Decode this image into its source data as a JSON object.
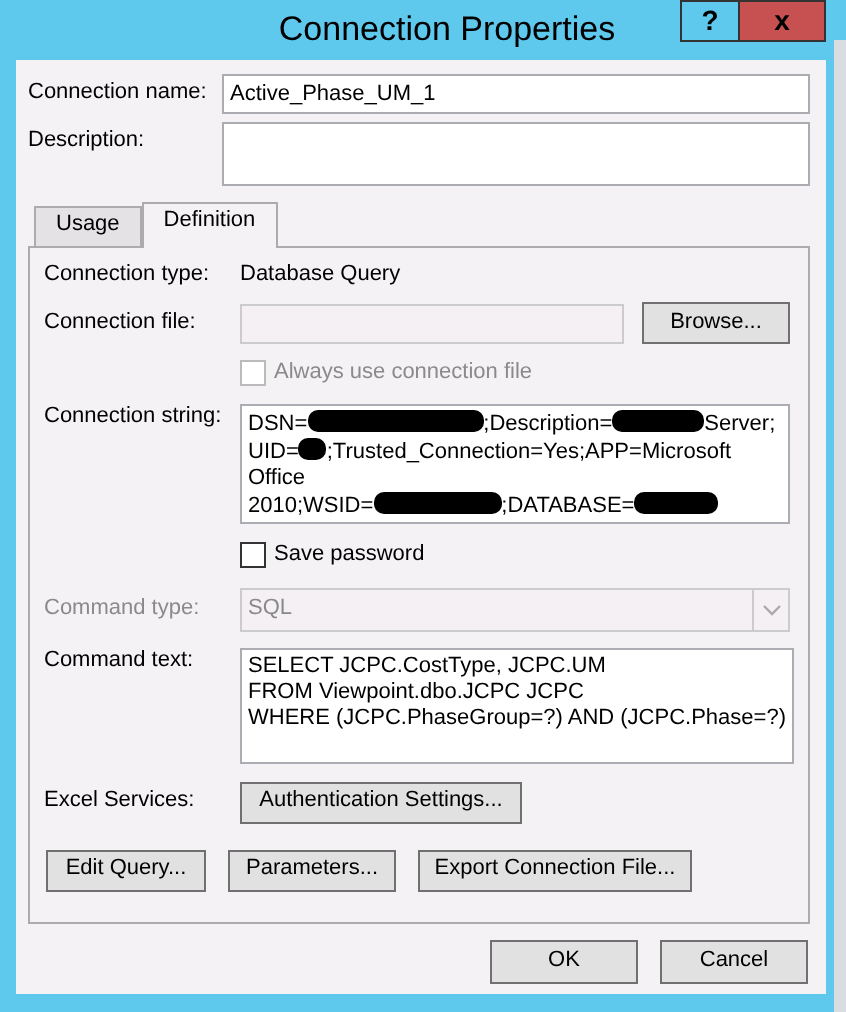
{
  "window": {
    "title": "Connection Properties"
  },
  "title_buttons": [
    {
      "kind": "help",
      "text": "?"
    },
    {
      "kind": "close",
      "text": "x"
    }
  ],
  "connection_name": {
    "label": "Connection name:",
    "value": "Active_Phase_UM_1"
  },
  "description": {
    "label": "Description:"
  },
  "tabs": [
    {
      "label": "Usage",
      "selected": false
    },
    {
      "label": "Definition",
      "selected": true
    }
  ],
  "definition": {
    "connection_type": {
      "label": "Connection type:",
      "value": "Database Query"
    },
    "connection_file": {
      "label": "Connection file:",
      "disabled": true,
      "button": {
        "label": "Browse..."
      }
    },
    "always_use_file": {
      "label": "Always use connection file",
      "checked": false,
      "disabled": true
    },
    "connection_string": {
      "label": "Connection string:",
      "lines": [
        [
          {
            "kind": "text",
            "text": "DSN="
          },
          {
            "kind": "redacted"
          },
          {
            "kind": "text",
            "text": ";Description="
          },
          {
            "kind": "redacted"
          },
          {
            "kind": "text",
            "text": "Server;"
          }
        ],
        [
          {
            "kind": "text",
            "text": "UID="
          },
          {
            "kind": "redacted"
          },
          {
            "kind": "text",
            "text": ";Trusted_Connection=Yes;APP=Microsoft"
          }
        ],
        [
          {
            "kind": "text",
            "text": "Office"
          }
        ],
        [
          {
            "kind": "text",
            "text": "2010;WSID="
          },
          {
            "kind": "redacted"
          },
          {
            "kind": "text",
            "text": ";DATABASE="
          },
          {
            "kind": "redacted"
          }
        ]
      ]
    },
    "save_password": {
      "label": "Save password",
      "checked": false,
      "disabled": false
    },
    "command_type": {
      "label": "Command type:",
      "value": "SQL",
      "disabled": true
    },
    "command_text": {
      "label": "Command text:",
      "lines": [
        "SELECT JCPC.CostType, JCPC.UM",
        "FROM Viewpoint.dbo.JCPC JCPC",
        "WHERE (JCPC.PhaseGroup=?) AND (JCPC.Phase=?)"
      ]
    },
    "excel_services": {
      "label": "Excel Services:",
      "button": {
        "label": "Authentication Settings..."
      }
    },
    "buttons": [
      {
        "label": "Edit Query..."
      },
      {
        "label": "Parameters..."
      },
      {
        "label": "Export Connection File..."
      }
    ]
  },
  "footer_buttons": [
    {
      "label": "OK"
    },
    {
      "label": "Cancel"
    }
  ]
}
